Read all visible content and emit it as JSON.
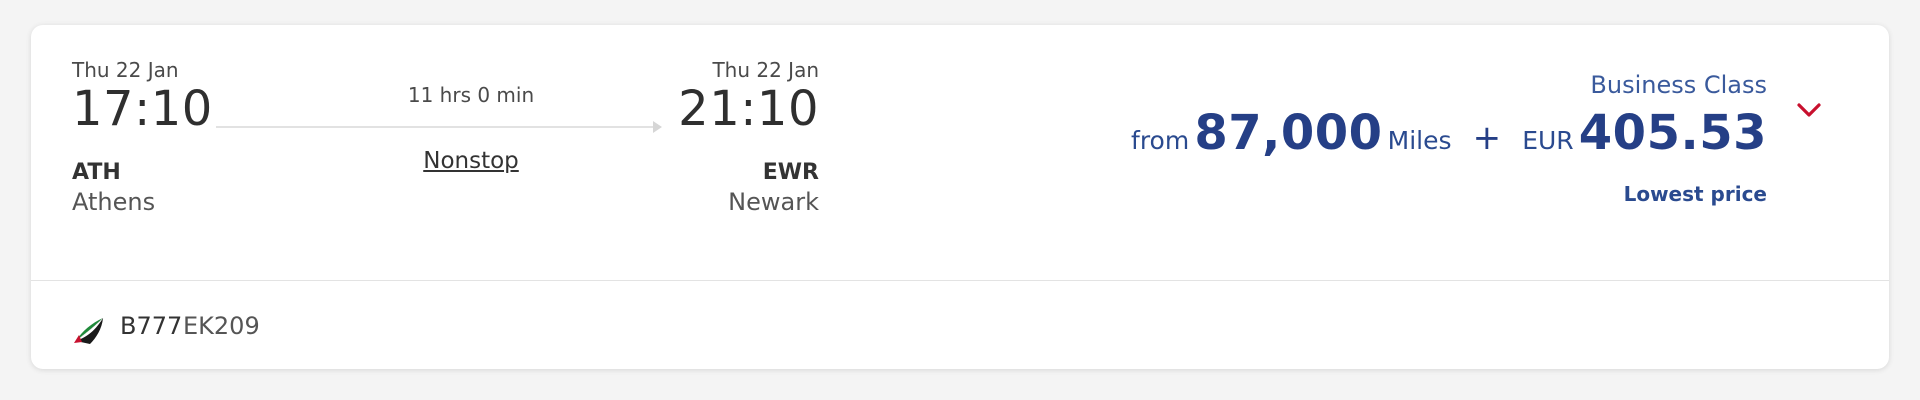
{
  "departure": {
    "date": "Thu 22 Jan",
    "time": "17:10",
    "code": "ATH",
    "city": "Athens"
  },
  "arrival": {
    "date": "Thu 22 Jan",
    "time": "21:10",
    "code": "EWR",
    "city": "Newark"
  },
  "route": {
    "duration": "11 hrs 0 min",
    "stops": "Nonstop"
  },
  "fare": {
    "cabin": "Business Class",
    "from_label": "from",
    "miles": "87,000",
    "miles_label": "Miles",
    "plus": "+",
    "currency": "EUR",
    "amount": "405.53",
    "tag": "Lowest price",
    "accent_color": "#c8102e",
    "price_color": "#253f86"
  },
  "flight": {
    "aircraft": "B777",
    "number": "EK209",
    "airline_logo": "emirates-flag-logo"
  },
  "icons": {
    "expand": "chevron-down-icon"
  }
}
